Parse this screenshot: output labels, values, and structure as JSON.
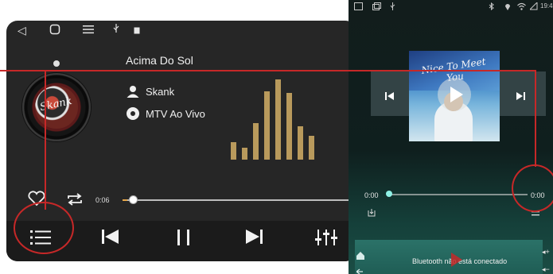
{
  "left_player": {
    "title": "Acima Do Sol",
    "artist": "Skank",
    "album": "MTV Ao Vivo",
    "disc_art_text": "Skank",
    "current_time": "0:06",
    "progress_fraction": 0.02,
    "eq_levels": [
      0.2,
      0.14,
      0.42,
      0.78,
      0.92,
      0.76,
      0.38,
      0.27
    ],
    "colors": {
      "accent": "#e8a84a",
      "eq": "#b99a5c",
      "background": "#262626"
    }
  },
  "right_player": {
    "album_art_title": "Nice To Meet You",
    "current_time": "0:00",
    "total_time": "0:00",
    "progress_fraction": 0.0,
    "bluetooth_status": "Bluetooth não está conectado",
    "status_time": "19:4",
    "colors": {
      "accent": "#8ff2e6",
      "annotation": "#c62828"
    }
  }
}
